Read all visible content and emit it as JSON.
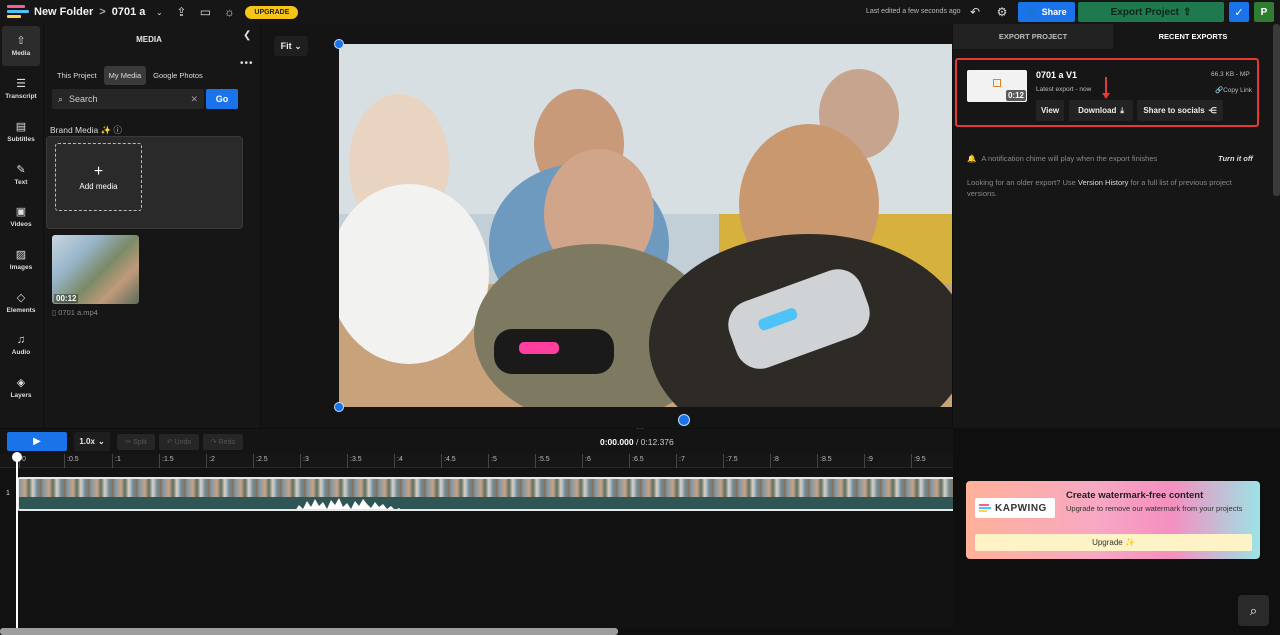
{
  "topbar": {
    "folder": "New Folder",
    "separator": ">",
    "project": "0701 a",
    "upgrade": "UPGRADE",
    "last_edited": "Last edited a few seconds ago",
    "share": "Share",
    "export": "Export Project",
    "avatar_initial": "P"
  },
  "sidebar": {
    "items": [
      {
        "label": "Media",
        "icon": "media-icon"
      },
      {
        "label": "Transcript",
        "icon": "transcript-icon"
      },
      {
        "label": "Subtitles",
        "icon": "subtitles-icon"
      },
      {
        "label": "Text",
        "icon": "text-icon"
      },
      {
        "label": "Videos",
        "icon": "videos-icon"
      },
      {
        "label": "Images",
        "icon": "images-icon"
      },
      {
        "label": "Elements",
        "icon": "elements-icon"
      },
      {
        "label": "Audio",
        "icon": "audio-icon"
      },
      {
        "label": "Layers",
        "icon": "layers-icon"
      }
    ]
  },
  "media": {
    "title": "MEDIA",
    "tabs": [
      "This Project",
      "My Media",
      "Google Photos"
    ],
    "active_tab": "My Media",
    "search_placeholder": "Search",
    "go": "Go",
    "brand_media": "Brand Media",
    "add_media": "Add media",
    "file_duration": "00:12",
    "file_name": "0701 a.mp4"
  },
  "preview": {
    "fit": "Fit"
  },
  "export_panel": {
    "tabs": [
      "EXPORT PROJECT",
      "RECENT EXPORTS"
    ],
    "active_tab": "RECENT EXPORTS",
    "card": {
      "title": "0701 a V1",
      "subtitle": "Latest export - now",
      "size": "66.3 KB - MP",
      "copy": "Copy Link",
      "duration": "0:12",
      "view": "View",
      "download": "Download",
      "share": "Share to socials"
    },
    "notification": "A notification chime will play when the export finishes",
    "turn_off": "Turn it off",
    "older_pre": "Looking for an older export? Use",
    "older_link": "Version History",
    "older_post": "for a full list of previous project versions."
  },
  "promo": {
    "logo": "KAPWING",
    "title": "Create watermark-free content",
    "desc": "Upgrade to remove our watermark from your projects",
    "button": "Upgrade ✨"
  },
  "timeline": {
    "speed": "1.0x",
    "split": "Split",
    "undo": "Undo",
    "redo": "Redo",
    "current_time": "0:00.000",
    "total_time": "/ 0:12.376",
    "track_number": "1",
    "ticks": [
      "0",
      ":0.5",
      ":1",
      ":1.5",
      ":2",
      ":2.5",
      ":3",
      ":3.5",
      ":4",
      ":4.5",
      ":5",
      ":5.5",
      ":6",
      ":6.5",
      ":7",
      ":7.5",
      ":8",
      ":8.5",
      ":9",
      ":9.5"
    ]
  },
  "colors": {
    "accent": "#1a73e8",
    "export_green": "#1e7a4e",
    "highlight_red": "#e53935",
    "upgrade_yellow": "#f5c518"
  }
}
